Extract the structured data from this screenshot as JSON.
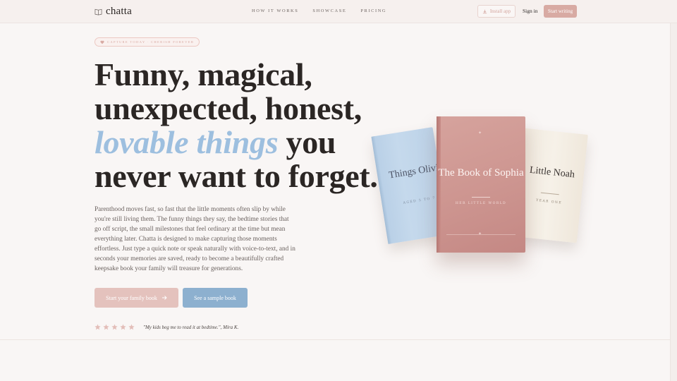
{
  "nav": {
    "logo_icon": "open-book-icon",
    "brand": "chatta",
    "links": [
      "HOW IT WORKS",
      "SHOWCASE",
      "PRICING"
    ],
    "install_label": "Install app",
    "signin_label": "Sign in",
    "start_label": "Start writing"
  },
  "hero": {
    "badge": "CAPTURE TODAY · CHERISH FOREVER",
    "headline_line1": "Funny, magical,",
    "headline_line2": "unexpected, honest,",
    "headline_accent": "lovable things",
    "headline_line3_rest": " you",
    "headline_line4": "never want to forget.",
    "body": "Parenthood moves fast, so fast that the little moments often slip by while you're still living them. The funny things they say, the bedtime stories that go off script, the small milestones that feel ordinary at the time but mean everything later. Chatta is designed to make capturing those moments effortless. Just type a quick note or speak naturally with voice-to-text, and in seconds your memories are saved, ready to become a beautifully crafted keepsake book your family will treasure for generations.",
    "cta_primary": "Start your family book",
    "cta_secondary": "See a sample book",
    "rating_stars": 5,
    "quote": "\"My kids beg me to read it at bedtime.\", Mira K."
  },
  "books": [
    {
      "title": "Things Olivia Says",
      "subtitle": "AGED 5 TO 7",
      "color": "#bcd2e8"
    },
    {
      "title": "The Book of Sophia",
      "subtitle": "HER LITTLE WORLD",
      "color": "#cd9590"
    },
    {
      "title": "Little Noah",
      "subtitle": "YEAR ONE",
      "color": "#f3ede3"
    }
  ],
  "colors": {
    "accent_rose": "#d8aaa3",
    "accent_blue": "#8db0cf",
    "text_dark": "#2b2624"
  }
}
